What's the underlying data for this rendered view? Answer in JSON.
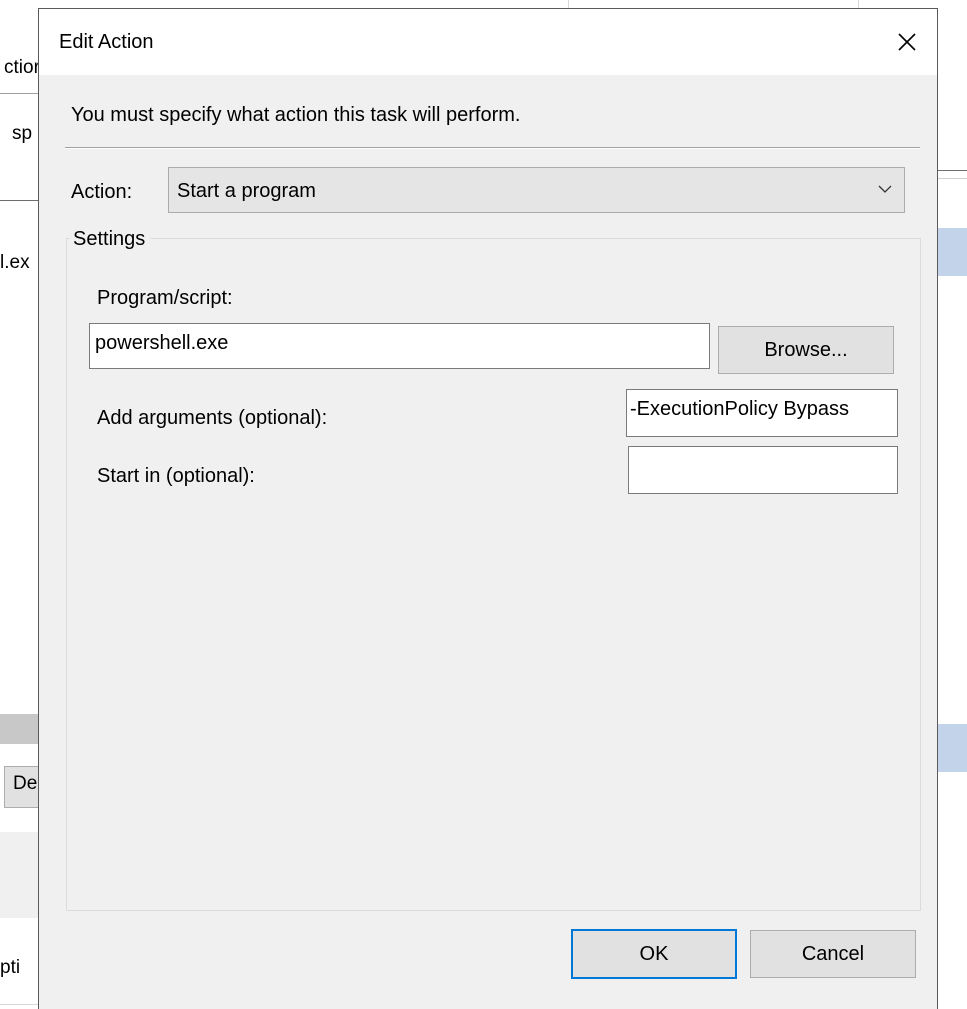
{
  "background_window": {
    "fragments": [
      "ctior",
      "sp",
      "l.ex",
      "De",
      "pti"
    ]
  },
  "dialog": {
    "title": "Edit Action",
    "close_icon": "close-icon",
    "instruction": "You must specify what action this task will perform.",
    "action": {
      "label": "Action:",
      "selected": "Start a program",
      "dropdown_icon": "chevron-down-icon"
    },
    "settings": {
      "legend": "Settings",
      "program_label": "Program/script:",
      "program_value": "powershell.exe",
      "browse_label": "Browse...",
      "arguments_label": "Add arguments (optional):",
      "arguments_value": "-ExecutionPolicy Bypass",
      "start_in_label": "Start in (optional):",
      "start_in_value": ""
    },
    "buttons": {
      "ok": "OK",
      "cancel": "Cancel"
    }
  },
  "colors": {
    "dialog_bg": "#f0f0f0",
    "accent": "#0078d7",
    "selection_blue": "#c3d3ea"
  }
}
